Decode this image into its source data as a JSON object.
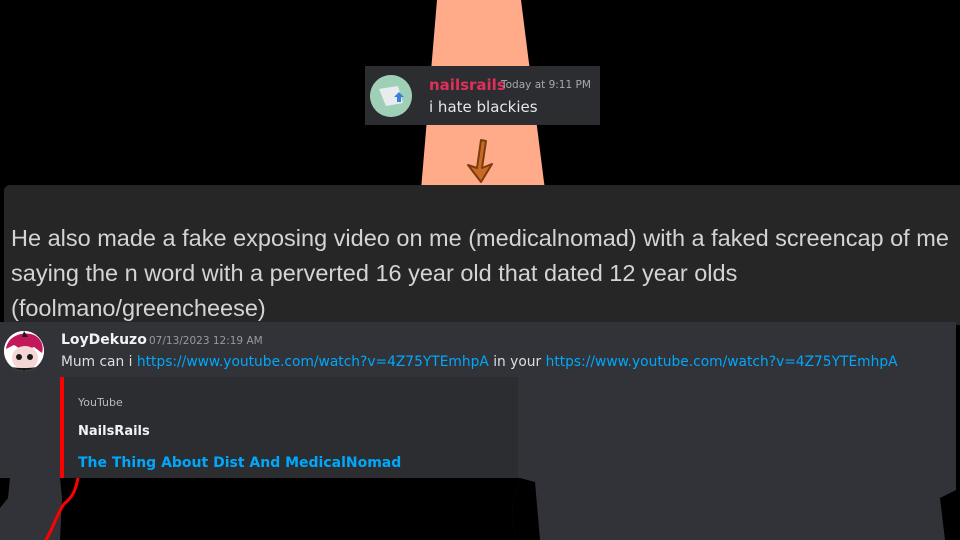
{
  "top_message": {
    "username": "nailsrails",
    "timestamp": "Today at 9:11 PM",
    "text": "i hate blackies"
  },
  "caption": "He also made a fake exposing video on me (medicalnomad) with a faked screencap of me saying the n word with a perverted 16 year old that dated 12 year olds (foolmano/greencheese)",
  "bottom_message": {
    "username": "LoyDekuzo",
    "timestamp": "07/13/2023 12:19 AM",
    "text_1": "Mum can i ",
    "link_1": "https://www.youtube.com/watch?v=4Z75YTEmhpA",
    "text_2": " in your ",
    "link_2": "https://www.youtube.com/watch?v=4Z75YTEmhpA",
    "embed": {
      "provider": "YouTube",
      "author": "NailsRails",
      "title": "The Thing About Dist And MedicalNomad",
      "accent_color": "#ff0000"
    }
  },
  "colors": {
    "beam": "#ffaa88",
    "username_top": "#e0305a",
    "link": "#00a8fc",
    "panel": "#262626"
  }
}
